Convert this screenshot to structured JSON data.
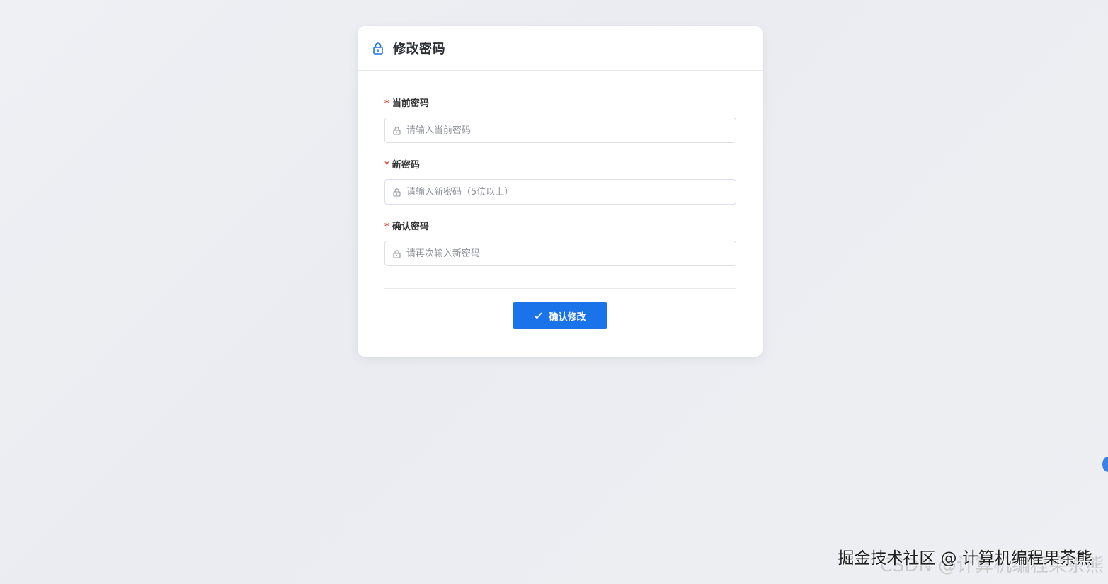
{
  "card": {
    "title": "修改密码",
    "header_icon": "lock-icon"
  },
  "fields": [
    {
      "label": "当前密码",
      "required_mark": "*",
      "placeholder": "请输入当前密码",
      "value": "",
      "icon": "lock-icon"
    },
    {
      "label": "新密码",
      "required_mark": "*",
      "placeholder": "请输入新密码（5位以上）",
      "value": "",
      "icon": "lock-icon"
    },
    {
      "label": "确认密码",
      "required_mark": "*",
      "placeholder": "请再次输入新密码",
      "value": "",
      "icon": "lock-icon"
    }
  ],
  "submit_button": {
    "label": "确认修改",
    "icon": "check-icon"
  },
  "watermark": {
    "text": "掘金技术社区 @ 计算机编程果茶熊",
    "ghost_text": "CSDN @计算机编程果茶熊"
  },
  "colors": {
    "accent": "#1a73e8",
    "required": "#e5473a",
    "background": "#eceef2"
  }
}
